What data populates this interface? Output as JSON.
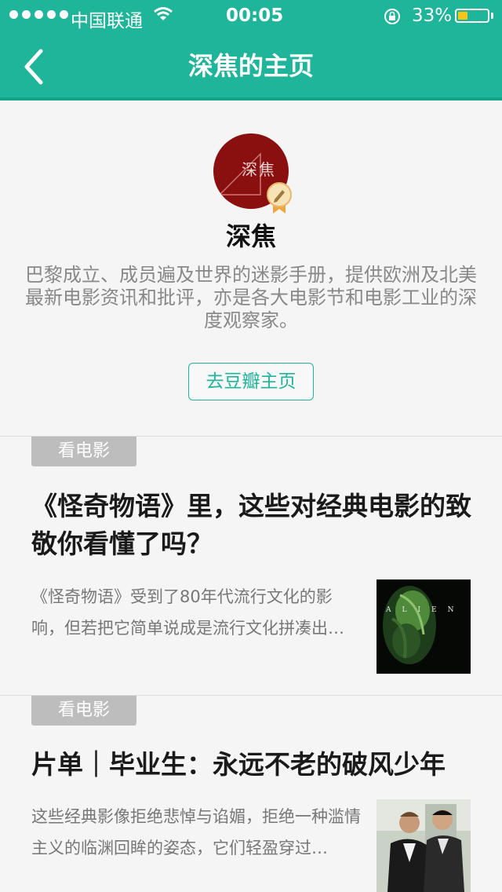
{
  "status_bar": {
    "carrier": "中国联通",
    "time": "00:05",
    "battery_percent": "33%",
    "battery_level": 0.33,
    "battery_color": "#f5c518"
  },
  "nav": {
    "title": "深焦的主页",
    "back_icon": "chevron-left-icon"
  },
  "profile": {
    "avatar_text": "深焦",
    "name": "深焦",
    "bio": "巴黎成立、成员遍及世界的迷影手册，提供欧洲及北美最新电影资讯和批评，亦是各大电影节和电影工业的深度观察家。",
    "douban_button": "去豆瓣主页"
  },
  "articles": [
    {
      "tag": "看电影",
      "title": "《怪奇物语》里，这些对经典电影的致敬你看懂了吗？",
      "excerpt": "《怪奇物语》受到了80年代流行文化的影响，但若把它简单说成是流行文化拼凑出…",
      "thumb_text": "ALIEN"
    },
    {
      "tag": "看电影",
      "title": "片单｜毕业生：永远不老的破风少年",
      "excerpt": "这些经典影像拒绝悲悼与谄媚，拒绝一种滥情主义的临渊回眸的姿态，它们轻盈穿过…"
    }
  ],
  "colors": {
    "brand": "#1fb59a",
    "tag_bg": "#bdbdbd"
  }
}
